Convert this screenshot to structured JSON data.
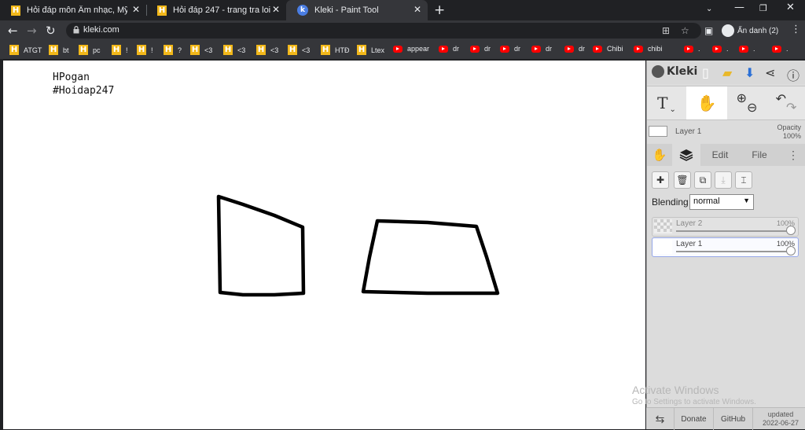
{
  "browser": {
    "tabs": [
      {
        "title": "Hỏi đáp môn Âm nhạc, Mỹ thuật",
        "icon": "hoidap-icon"
      },
      {
        "title": "Hỏi đáp 247 - trang tra loi",
        "icon": "hoidap-icon"
      },
      {
        "title": "Kleki - Paint Tool",
        "icon": "kleki-icon"
      }
    ],
    "url": "kleki.com",
    "profile_label": "Ẩn danh (2)",
    "bookmarks": [
      {
        "label": "ATGT",
        "type": "h"
      },
      {
        "label": "bt",
        "type": "h"
      },
      {
        "label": "pc",
        "type": "h"
      },
      {
        "label": "!",
        "type": "h"
      },
      {
        "label": "!",
        "type": "h"
      },
      {
        "label": "?",
        "type": "h"
      },
      {
        "label": "<3",
        "type": "h"
      },
      {
        "label": "<3",
        "type": "h"
      },
      {
        "label": "<3",
        "type": "h"
      },
      {
        "label": "<3",
        "type": "h"
      },
      {
        "label": "HTĐ",
        "type": "h"
      },
      {
        "label": "Ltex",
        "type": "h"
      },
      {
        "label": "appear",
        "type": "yt"
      },
      {
        "label": "dr",
        "type": "yt"
      },
      {
        "label": "dr",
        "type": "yt"
      },
      {
        "label": "dr",
        "type": "yt"
      },
      {
        "label": "dr",
        "type": "yt"
      },
      {
        "label": "dr",
        "type": "yt"
      },
      {
        "label": "Chibi",
        "type": "yt"
      },
      {
        "label": "chibi",
        "type": "yt"
      },
      {
        "label": ".",
        "type": "yt"
      },
      {
        "label": ".",
        "type": "yt"
      },
      {
        "label": ".",
        "type": "yt"
      },
      {
        "label": ".",
        "type": "yt"
      }
    ]
  },
  "canvas": {
    "text_line1": "HPogan",
    "text_line2": "#Hoidap247"
  },
  "kleki": {
    "logo": "Kleki",
    "current_layer": "Layer 1",
    "opacity_label": "Opacity",
    "opacity_value": "100%",
    "tabs": {
      "edit": "Edit",
      "file": "File"
    },
    "blending_label": "Blending",
    "blending_value": "normal",
    "layers": [
      {
        "name": "Layer 2",
        "opacity": "100%"
      },
      {
        "name": "Layer 1",
        "opacity": "100%"
      }
    ],
    "footer": {
      "donate": "Donate",
      "github": "GitHub",
      "updated_label": "updated",
      "updated_date": "2022-06-27"
    }
  },
  "watermark": {
    "line1": "Activate Windows",
    "line2": "Go to Settings to activate Windows."
  },
  "colors": {
    "chrome_dark": "#202124",
    "chrome_toolbar": "#35363a",
    "kleki_panel": "#dcdcdc",
    "accent_blue": "#1a73e8"
  }
}
